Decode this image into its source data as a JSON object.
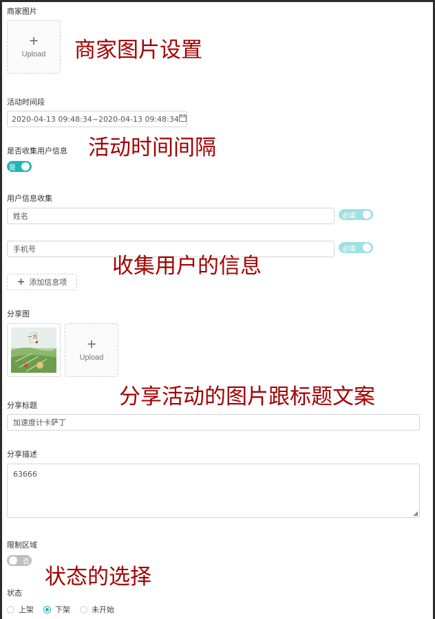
{
  "merchant_image": {
    "label": "商家图片",
    "upload_label": "Upload",
    "annotation": "商家图片设置"
  },
  "activity_time": {
    "label": "活动时间段",
    "value": "2020-04-13 09:48:34~2020-04-13 09:48:34",
    "icon": "calendar-icon",
    "annotation": "活动时间间隔"
  },
  "collect_info": {
    "label": "是否收集用户信息",
    "switch_label": "是",
    "enabled": true
  },
  "user_info": {
    "label": "用户信息收集",
    "fields": [
      {
        "value": "姓名",
        "required_label": "必填"
      },
      {
        "value": "手机号",
        "required_label": "必填"
      }
    ],
    "add_button_label": "添加信息项",
    "annotation": "收集用户的信息"
  },
  "share_image": {
    "label": "分享图",
    "upload_label": "Upload",
    "annotation": "分享活动的图片跟标题文案"
  },
  "share_title": {
    "label": "分享标题",
    "value": "加速度计卡萨丁"
  },
  "share_desc": {
    "label": "分享描述",
    "value": "63666"
  },
  "limit_region": {
    "label": "限制区域",
    "switch_label": "否",
    "enabled": false,
    "annotation": "状态的选择"
  },
  "status": {
    "label": "状态",
    "options": [
      "上架",
      "下架",
      "未开始"
    ],
    "selected": "下架"
  },
  "colors": {
    "accent": "#21b5b5",
    "annotation": "#a30000"
  }
}
